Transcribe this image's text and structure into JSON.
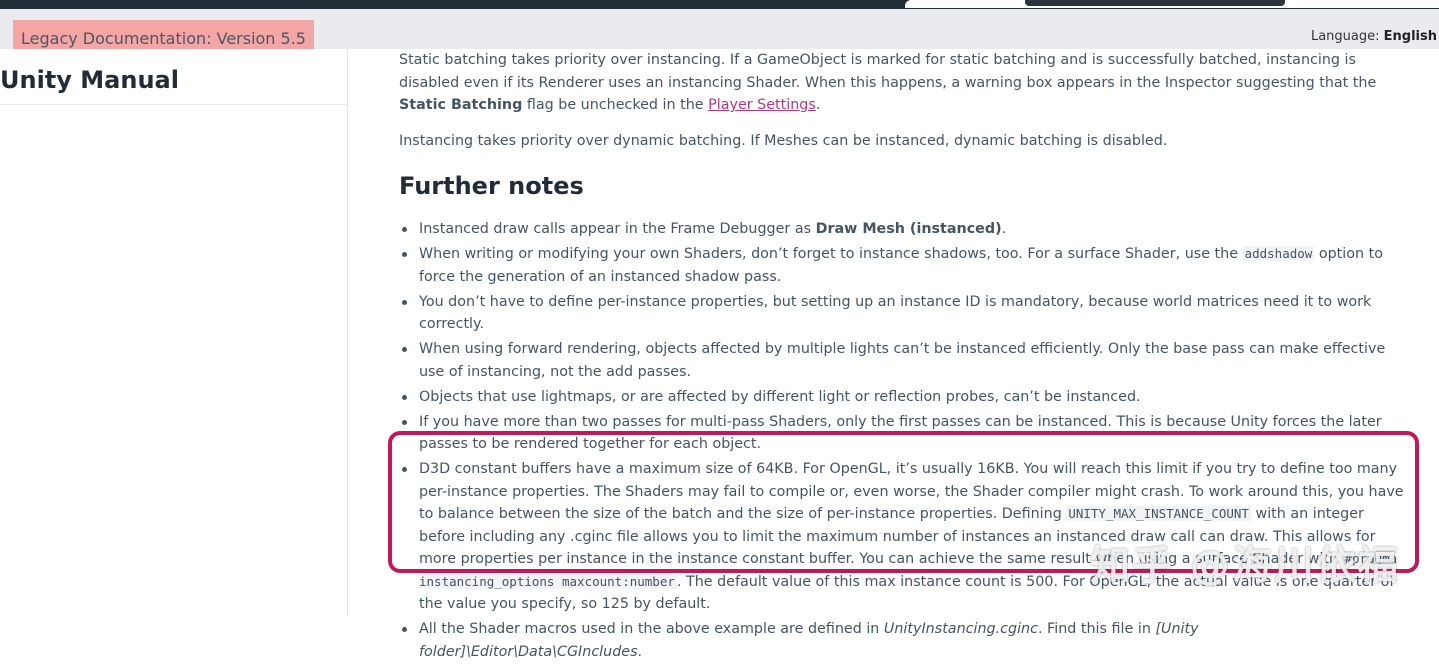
{
  "legacy_banner": {
    "label": "Legacy Documentation: Version 5.5"
  },
  "language": {
    "prefix": "Language:",
    "value": "English"
  },
  "sidebar": {
    "title": "Unity Manual"
  },
  "content": {
    "p1_text1": "Static batching takes priority over instancing. If a GameObject is marked for static batching and is successfully batched, instancing is disabled even if its Renderer uses an instancing Shader. When this happens, a warning box appears in the Inspector suggesting that the ",
    "p1_bold": "Static Batching",
    "p1_text2": " flag be unchecked in the ",
    "p1_link": "Player Settings",
    "p1_text3": ".",
    "p2": "Instancing takes priority over dynamic batching. If Meshes can be instanced, dynamic batching is disabled.",
    "heading": "Further notes",
    "notes": {
      "n1_a": "Instanced draw calls appear in the Frame Debugger as ",
      "n1_b": "Draw Mesh (instanced)",
      "n1_c": ".",
      "n2_a": "When writing or modifying your own Shaders, don’t forget to instance shadows, too. For a surface Shader, use the ",
      "n2_code": "addshadow",
      "n2_b": " option to force the generation of an instanced shadow pass.",
      "n3": "You don’t have to define per-instance properties, but setting up an instance ID is mandatory, because world matrices need it to work correctly.",
      "n4": "When using forward rendering, objects affected by multiple lights can’t be instanced efficiently. Only the base pass can make effective use of instancing, not the add passes.",
      "n5": "Objects that use lightmaps, or are affected by different light or reflection probes, can’t be instanced.",
      "n6": "If you have more than two passes for multi-pass Shaders, only the first passes can be instanced. This is because Unity forces the later passes to be rendered together for each object.",
      "n7_a": "D3D constant buffers have a maximum size of 64KB. For OpenGL, it’s usually 16KB. You will reach this limit if you try to define too many per-instance properties. The Shaders may fail to compile or, even worse, the Shader compiler might crash. To work around this, you have to balance between the size of the batch and the size of per-instance properties. Defining ",
      "n7_code1": "UNITY_MAX_INSTANCE_COUNT",
      "n7_b": " with an integer before including any .cginc file allows you to limit the maximum number of instances an instanced draw call can draw. This allows for more properties per instance in the instance constant buffer. You can achieve the same result when using a surface Shader with ",
      "n7_code2": "#pragma instancing_options maxcount:number",
      "n7_c": ". The default value of this max instance count is 500. For OpenGL, the actual value is one quarter of the value you specify, so 125 by default.",
      "n8_a": "All the Shader macros used in the above example are defined in ",
      "n8_i1": "UnityInstancing.cginc",
      "n8_b": ". Find this file in ",
      "n8_i2": "[Unity folder]\\Editor\\Data\\CGIncludes",
      "n8_c": "."
    }
  },
  "watermark": "知乎 @海川依福",
  "colors": {
    "highlight": "#c2185b",
    "link": "#b5377d",
    "legacy_bg": "#f4a6a6"
  }
}
